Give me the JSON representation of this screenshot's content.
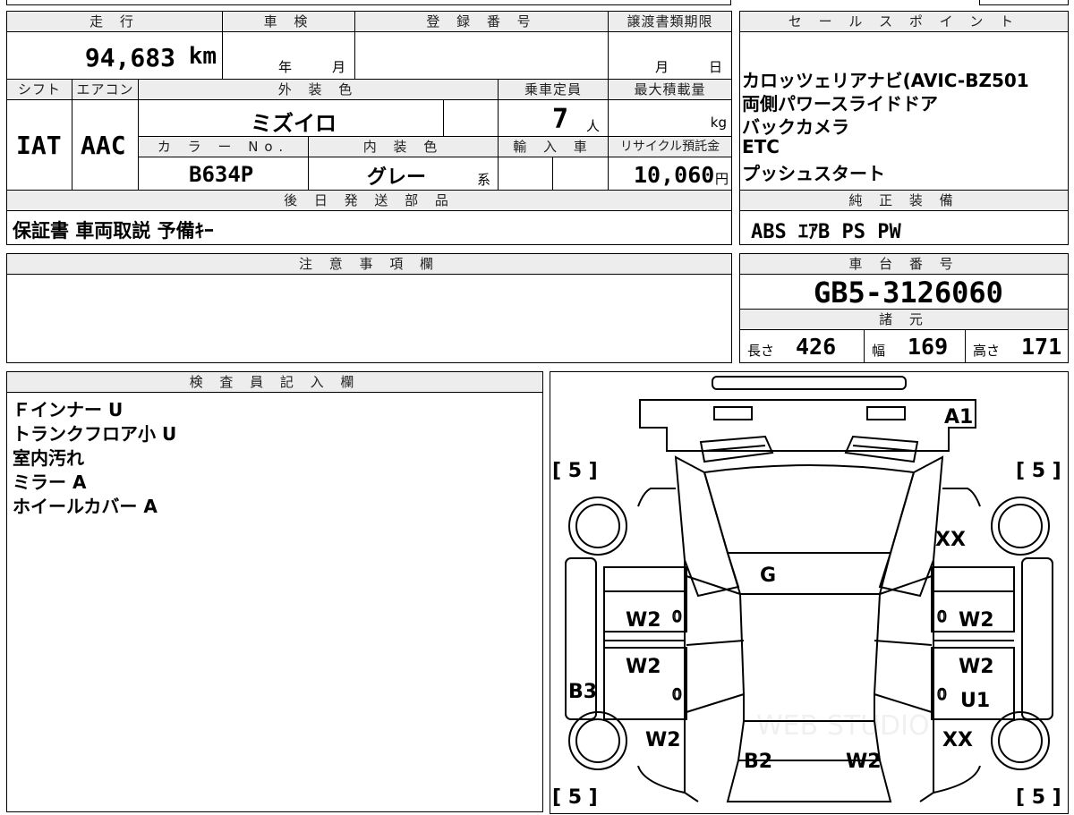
{
  "headers": {
    "mileage": "走 行",
    "inspection": "車 検",
    "registration": "登 録 番 号",
    "transfer_deadline": "譲渡書類期限",
    "sales_points": "セ ー ル ス ポ イ ン ト",
    "shift": "シフト",
    "aircon": "エアコン",
    "exterior_color": "外 装 色",
    "capacity": "乗車定員",
    "max_load": "最大積載量",
    "color_no": "カ ラ ー No.",
    "interior_color": "内 装 色",
    "import": "輸 入 車",
    "recycle": "リサイクル預託金",
    "later_parts": "後 日 発 送 部 品",
    "standard_equipment": "純 正 装 備",
    "notes": "注 意 事 項 欄",
    "chassis_no": "車 台 番 号",
    "specs": "諸 元",
    "inspector": "検 査 員 記 入 欄"
  },
  "vehicle": {
    "mileage": "94,683",
    "mileage_unit": "km",
    "inspection_year_unit": "年",
    "inspection_month_unit": "月",
    "transfer_month_unit": "月",
    "transfer_day_unit": "日",
    "shift": "IAT",
    "aircon": "AAC",
    "exterior_color": "ミズイロ",
    "capacity": "7",
    "capacity_unit": "人",
    "max_load_unit": "kg",
    "color_no": "B634P",
    "interior_color": "グレー",
    "interior_suffix": "系",
    "recycle_fee": "10,060",
    "recycle_unit": "円",
    "later_parts": "保証書 車両取説 予備ｷｰ",
    "standard_equipment": "ABS ｴｱB PS PW",
    "chassis_no": "GB5-3126060",
    "length_label": "長さ",
    "length": "426",
    "width_label": "幅",
    "width": "169",
    "height_label": "高さ",
    "height": "171"
  },
  "sales_points": [
    "カロッツェリアナビ(AVIC-BZ501",
    "両側パワースライドドア",
    "バックカメラ",
    "ETC",
    "プッシュスタート"
  ],
  "inspector_notes": [
    "Ｆインナー U",
    "トランクフロア小 U",
    "室内汚れ",
    "ミラー A",
    "ホイールカバー A"
  ],
  "diagram": {
    "tire_tl": "[ 5 ]",
    "tire_tr": "[ 5 ]",
    "tire_bl": "[ 5 ]",
    "tire_br": "[ 5 ]",
    "front_bumper": "A1",
    "right_front_fender": "XX",
    "windshield": "G",
    "left_front_door": "W2",
    "right_front_door": "W2",
    "left_front_door_mark": "0",
    "right_front_door_mark": "0",
    "left_rear_door": "W2",
    "right_rear_door": "W2",
    "left_rear_door_mark": "0",
    "right_rear_door_mark": "0",
    "left_rocker": "B3",
    "right_rear_door_2": "U1",
    "left_rear_fender": "W2",
    "right_rear_fender": "XX",
    "rear_left": "B2",
    "rear_right": "W2",
    "watermark": "WEB STUDIO"
  }
}
